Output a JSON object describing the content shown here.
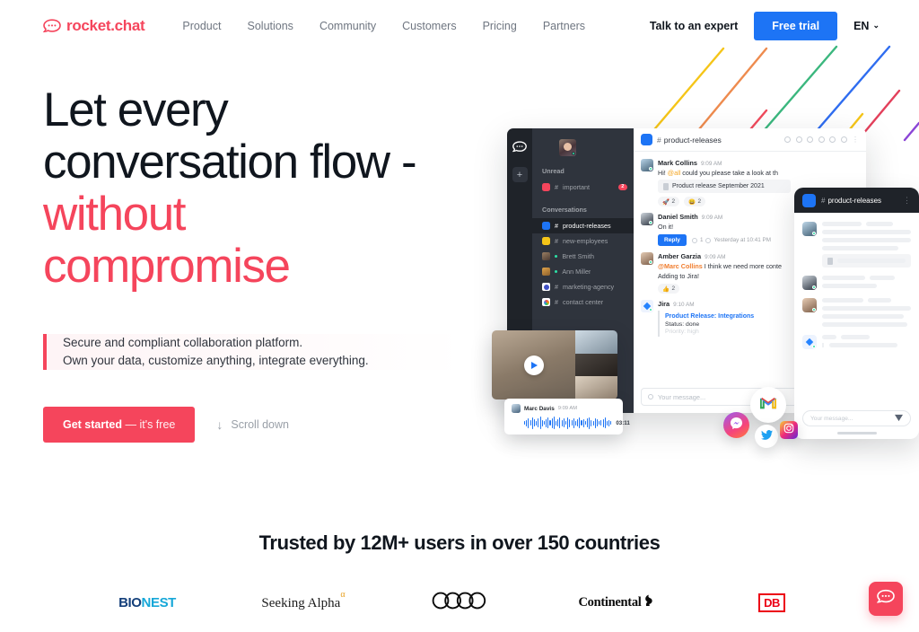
{
  "header": {
    "logo_text": "rocket.chat",
    "nav": [
      {
        "label": "Product"
      },
      {
        "label": "Solutions"
      },
      {
        "label": "Community"
      },
      {
        "label": "Customers"
      },
      {
        "label": "Pricing"
      },
      {
        "label": "Partners"
      }
    ],
    "talk_to_expert": "Talk to an expert",
    "free_trial": "Free trial",
    "language": "EN",
    "chevron": "⌄"
  },
  "hero": {
    "headline_line1": "Let every",
    "headline_line2": "conversation flow -",
    "headline_line3": "without",
    "headline_line4": "compromise",
    "subtitle_line1": "Secure and compliant collaboration platform.",
    "subtitle_line2": "Own your data, customize anything, integrate everything.",
    "cta_bold": "Get started",
    "cta_rest": " — it's free",
    "scroll_label": "Scroll down",
    "scroll_arrow": "↓"
  },
  "app": {
    "sidebar": {
      "unread_label": "Unread",
      "conversations_label": "Conversations",
      "unread_items": [
        {
          "name": "important",
          "hash": "#",
          "color": "#F5455C",
          "badge": "2"
        }
      ],
      "items": [
        {
          "name": "product-releases",
          "hash": "#",
          "color": "#1D74F5",
          "type": "channel",
          "active": true
        },
        {
          "name": "new-employees",
          "hash": "#",
          "color": "#F5C518",
          "type": "channel",
          "active": false
        },
        {
          "name": "Brett Smith",
          "hash": "",
          "color": "#6f5b4a",
          "type": "dm",
          "active": false
        },
        {
          "name": "Ann Miller",
          "hash": "",
          "color": "#d39a3c",
          "type": "dm",
          "active": false
        },
        {
          "name": "marketing-agency",
          "hash": "#",
          "color": "#3b4fb8",
          "type": "app",
          "active": false
        },
        {
          "name": "contact center",
          "hash": "#",
          "color": "#e8e8ee",
          "type": "app",
          "active": false
        }
      ]
    },
    "channel_title": "product-releases",
    "channel_hash": "#",
    "messages": [
      {
        "author": "Mark Collins",
        "time": "9:09 AM",
        "text_pre": "Hi! ",
        "mention": "@all",
        "text_post": " could you please take a look at th",
        "attachment": "Product release September 2021",
        "reactions": [
          {
            "emoji": "🚀",
            "count": "2"
          },
          {
            "emoji": "😄",
            "count": "2"
          }
        ]
      },
      {
        "author": "Daniel Smith",
        "time": "9:09 AM",
        "text": "On it!",
        "reply_label": "Reply",
        "reply_count": "1",
        "reply_meta": "Yesterday at 10:41 PM"
      },
      {
        "author": "Amber Garzia",
        "time": "9:09 AM",
        "mention": "@Marc Collins",
        "text_post": " I think we need more conte",
        "text_line2": "Adding to Jira!",
        "reactions": [
          {
            "emoji": "👍",
            "count": "2"
          }
        ]
      },
      {
        "author": "Jira",
        "time": "9:10 AM",
        "card_title": "Product Release: Integrations",
        "card_line1": "Status: done",
        "card_line2": "Priority: high"
      }
    ],
    "composer_placeholder": "Your message..."
  },
  "video": {
    "play_label": "play-video"
  },
  "audio": {
    "author": "Marc Davis",
    "time": "9:09 AM",
    "duration": "03:11"
  },
  "phone": {
    "channel_title": "product-releases",
    "channel_hash": "#",
    "composer_placeholder": "Your message..."
  },
  "social": [
    {
      "name": "gmail",
      "glyph": "M"
    },
    {
      "name": "messenger",
      "glyph": ""
    },
    {
      "name": "twitter",
      "glyph": ""
    },
    {
      "name": "instagram",
      "glyph": ""
    }
  ],
  "trusted": {
    "heading": "Trusted by 12M+ users in over 150 countries",
    "logos": [
      {
        "name": "BIONEST",
        "part1": "BIO",
        "part2": "NEST"
      },
      {
        "name": "Seeking Alpha",
        "text": "Seeking Alpha",
        "sup": "α"
      },
      {
        "name": "Audi",
        "text": ""
      },
      {
        "name": "Continental",
        "text": "Continental"
      },
      {
        "name": "DB",
        "text": "DB"
      }
    ]
  },
  "colors": {
    "brand_red": "#F5455C",
    "brand_blue": "#1D74F5",
    "dark": "#10161e",
    "sidebar_dark": "#2F343D",
    "rail_dark": "#1F2329"
  }
}
